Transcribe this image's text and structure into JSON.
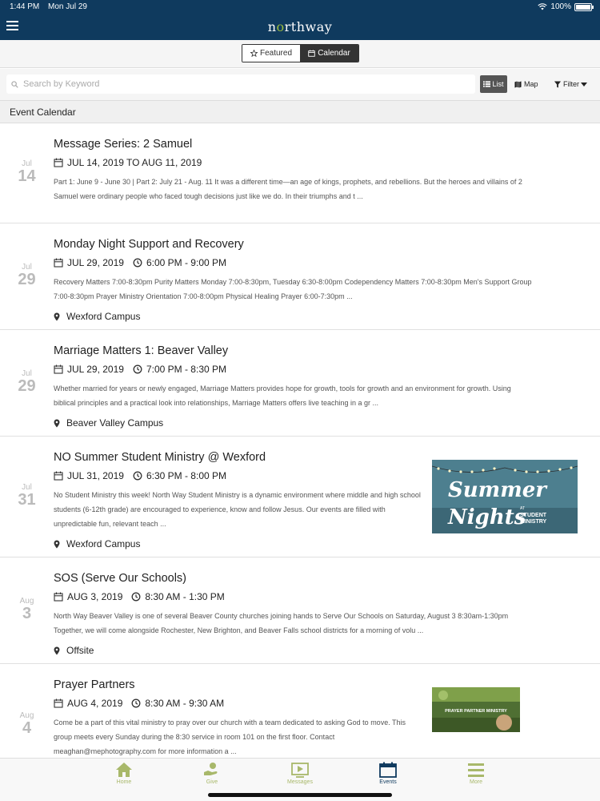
{
  "status": {
    "time": "1:44 PM",
    "date": "Mon Jul 29",
    "battery": "100%"
  },
  "brand": {
    "pre": "n",
    "accent": "o",
    "post": "rthway",
    "color": "#0f3a5e",
    "accent_color": "#9bbc3b"
  },
  "segments": {
    "featured": "Featured",
    "calendar": "Calendar",
    "selected": "Calendar"
  },
  "search": {
    "placeholder": "Search by Keyword"
  },
  "view": {
    "list": "List",
    "map": "Map",
    "filter": "Filter",
    "selected": "List"
  },
  "section_title": "Event Calendar",
  "events": [
    {
      "month": "Jul",
      "day": "14",
      "title": "Message Series: 2 Samuel",
      "date": "JUL 14, 2019 TO AUG 11, 2019",
      "time": "",
      "desc": "Part 1: June 9 - June 30 | Part 2: July 21 - Aug. 11 It was a different time—an age of kings, prophets, and rebellions. But the heroes and villains of 2 Samuel were ordinary people who faced tough decisions just like we do. In their triumphs and t ...",
      "location": ""
    },
    {
      "month": "Jul",
      "day": "29",
      "title": "Monday Night Support and Recovery",
      "date": "JUL 29, 2019",
      "time": "6:00 PM - 9:00 PM",
      "desc": "Recovery Matters 7:00-8:30pm Purity Matters Monday 7:00-8:30pm, Tuesday 6:30-8:00pm Codependency Matters 7:00-8:30pm Men's Support Group 7:00-8:30pm Prayer Ministry Orientation 7:00-8:00pm Physical Healing Prayer 6:00-7:30pm ...",
      "location": "Wexford Campus"
    },
    {
      "month": "Jul",
      "day": "29",
      "title": "Marriage Matters 1: Beaver Valley",
      "date": "JUL 29, 2019",
      "time": "7:00 PM - 8:30 PM",
      "desc": "Whether married for years or newly engaged, Marriage Matters provides hope for growth, tools for growth and an environment for growth. Using biblical principles and a practical look into relationships, Marriage Matters offers live teaching in a gr ...",
      "location": "Beaver Valley Campus"
    },
    {
      "month": "Jul",
      "day": "31",
      "title": "NO Summer Student Ministry @ Wexford",
      "date": "JUL 31, 2019",
      "time": "6:30 PM - 8:00 PM",
      "desc": "No Student Ministry this week! North Way Student Ministry is a dynamic environment where middle and high school students (6-12th grade) are encouraged to experience, know and follow Jesus. Our events are filled with unpredictable fun, relevant teach ...",
      "location": "Wexford Campus",
      "thumb": {
        "line1": "Summer",
        "line2": "Nights",
        "sub1": "AT",
        "sub2": "STUDENT",
        "sub3": "MINISTRY"
      }
    },
    {
      "month": "Aug",
      "day": "3",
      "title": "SOS (Serve Our Schools)",
      "date": "AUG 3, 2019",
      "time": "8:30 AM - 1:30 PM",
      "desc": "North Way Beaver Valley is one of several Beaver County churches joining hands to Serve Our Schools on Saturday, August 3 8:30am-1:30pm Together, we will come alongside Rochester, New Brighton, and Beaver Falls school districts for a morning of volu ...",
      "location": "Offsite"
    },
    {
      "month": "Aug",
      "day": "4",
      "title": "Prayer Partners",
      "date": "AUG 4, 2019",
      "time": "8:30 AM - 9:30 AM",
      "desc": "Come be a part of this vital ministry to pray over our church with a team dedicated to asking God to move. This group meets every Sunday during the 8:30 service in room 101 on the first floor. Contact meaghan@mephotography.com for more information a ...",
      "location": "",
      "thumb": {
        "line1": "PRAYER PARTNER MINISTRY"
      }
    }
  ],
  "tabs": [
    {
      "label": "Home",
      "icon": "home-icon"
    },
    {
      "label": "Give",
      "icon": "give-icon"
    },
    {
      "label": "Messages",
      "icon": "messages-icon"
    },
    {
      "label": "Events",
      "icon": "calendar-icon"
    },
    {
      "label": "More",
      "icon": "menu-icon"
    }
  ],
  "active_tab": "Events"
}
